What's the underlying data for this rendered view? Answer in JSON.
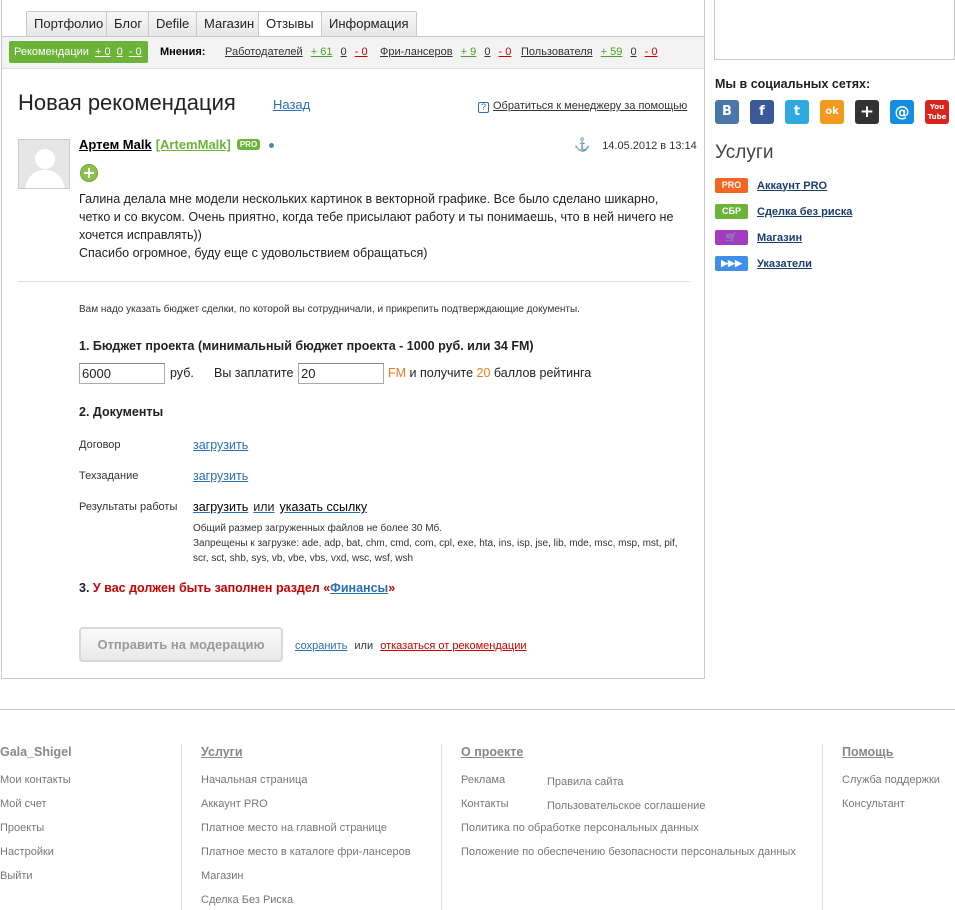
{
  "tabs": [
    "Портфолио",
    "Блог",
    "Defile",
    "Магазин",
    "Отзывы",
    "Информация"
  ],
  "subbar": {
    "rec_label": "Рекомендации",
    "rec_pos": "+ 0",
    "rec_zero": "0",
    "rec_neg": "- 0",
    "opinions_label": "Мнения:",
    "groups": [
      {
        "label": "Работодателей",
        "pos": "+ 61",
        "zero": "0",
        "neg": "- 0"
      },
      {
        "label": "Фри-лансеров",
        "pos": "+ 9",
        "zero": "0",
        "neg": "- 0"
      },
      {
        "label": "Пользователя",
        "pos": "+ 59",
        "zero": "0",
        "neg": "- 0"
      }
    ]
  },
  "page": {
    "title": "Новая рекомендация",
    "back": "Назад",
    "manager_link": "Обратиться к менеджеру за помощью"
  },
  "review": {
    "author_name": "Артем Malk",
    "author_login": "[ArtemMalk]",
    "pro_badge": "PRO",
    "date": "14.05.2012 в 13:14",
    "text_line1": "Галина делала мне модели нескольких картинок в векторной графике. Все было сделано шикарно, четко и со вкусом. Очень приятно, когда тебе присылают работу и ты понимаешь, что в ней ничего не хочется исправлять))",
    "text_line2": "Спасибо огромное, буду еще с удовольствием обращаться)"
  },
  "form": {
    "note": "Вам надо указать бюджет сделки, по которой вы сотрудничали, и прикрепить подтверждающие документы.",
    "section1": "1. Бюджет проекта (минимальный бюджет проекта - 1000 руб. или 34 FM)",
    "budget_value": "6000",
    "rub": "руб.",
    "pay_label": "Вы заплатите",
    "pay_value": "20",
    "fm": "FM",
    "and_get": "и получите",
    "points": "20",
    "points_label": "баллов рейтинга",
    "section2": "2. Документы",
    "doc_contract": "Договор",
    "doc_spec": "Техзадание",
    "doc_results": "Результаты работы",
    "upload": "загрузить",
    "or": "или",
    "link_label": "указать ссылку",
    "limit_size": "Общий размер загруженных файлов не более 30 Мб.",
    "limit_types": "Запрещены к загрузке: ade, adp, bat, chm, cmd, com, cpl, exe, hta, ins, isp, jse, lib, mde, msc, msp, mst, pif, scr, sct, shb, sys, vb, vbe, vbs, vxd, wsc, wsf, wsh",
    "section3_num": "3.",
    "section3_text": "У вас должен быть заполнен раздел «",
    "section3_link": "Финансы",
    "section3_end": "»",
    "send_button": "Отправить на модерацию",
    "save_link": "сохранить",
    "or2": "или",
    "cancel_link": "отказаться от рекомендации"
  },
  "sidebar": {
    "social_title": "Мы в социальных сетях:",
    "social": [
      {
        "icon": "vk-icon",
        "glyph": "B",
        "color": "#4a76a8"
      },
      {
        "icon": "facebook-icon",
        "glyph": "f",
        "color": "#3b5998"
      },
      {
        "icon": "twitter-icon",
        "glyph": "t",
        "color": "#2fa9e0"
      },
      {
        "icon": "odnoklassniki-icon",
        "glyph": "ok",
        "color": "#f39a1e"
      },
      {
        "icon": "googleplus-icon",
        "glyph": "+",
        "color": "#333333"
      },
      {
        "icon": "mailru-icon",
        "glyph": "@",
        "color": "#168de2"
      },
      {
        "icon": "youtube-icon",
        "glyph": "You Tube",
        "color": "#d9251d"
      }
    ],
    "services_title": "Услуги",
    "services": [
      {
        "badge": "PRO",
        "label": "Аккаунт PRO",
        "color": "#f26522"
      },
      {
        "badge": "СБР",
        "label": "Сделка без риска",
        "color": "#6bb339"
      },
      {
        "badge": "🛒",
        "label": "Магазин",
        "color": "#a23cc0"
      },
      {
        "badge": "▶▶▶",
        "label": "Указатели",
        "color": "#3d8fe8"
      }
    ]
  },
  "footer": {
    "col1_title": "Gala_Shigel",
    "col1": [
      "Мои контакты",
      "Мой счет",
      "Проекты",
      "Настройки",
      "Выйти"
    ],
    "col2_title": "Услуги",
    "col2": [
      "Начальная страница",
      "Аккаунт PRO",
      "Платное место на главной странице",
      "Платное место в каталоге фри-лансеров",
      "Магазин",
      "Сделка Без Риска"
    ],
    "col3_title": "О проекте",
    "col3a": [
      "Реклама",
      "Контакты"
    ],
    "col3b": [
      "Правила сайта",
      "Пользовательское соглашение"
    ],
    "col3c": [
      "Политика по обработке персональных данных",
      "Положение по обеспечению безопасности персональных данных"
    ],
    "col4_title": "Помощь",
    "col4": [
      "Служба поддержки",
      "Консультант"
    ]
  }
}
